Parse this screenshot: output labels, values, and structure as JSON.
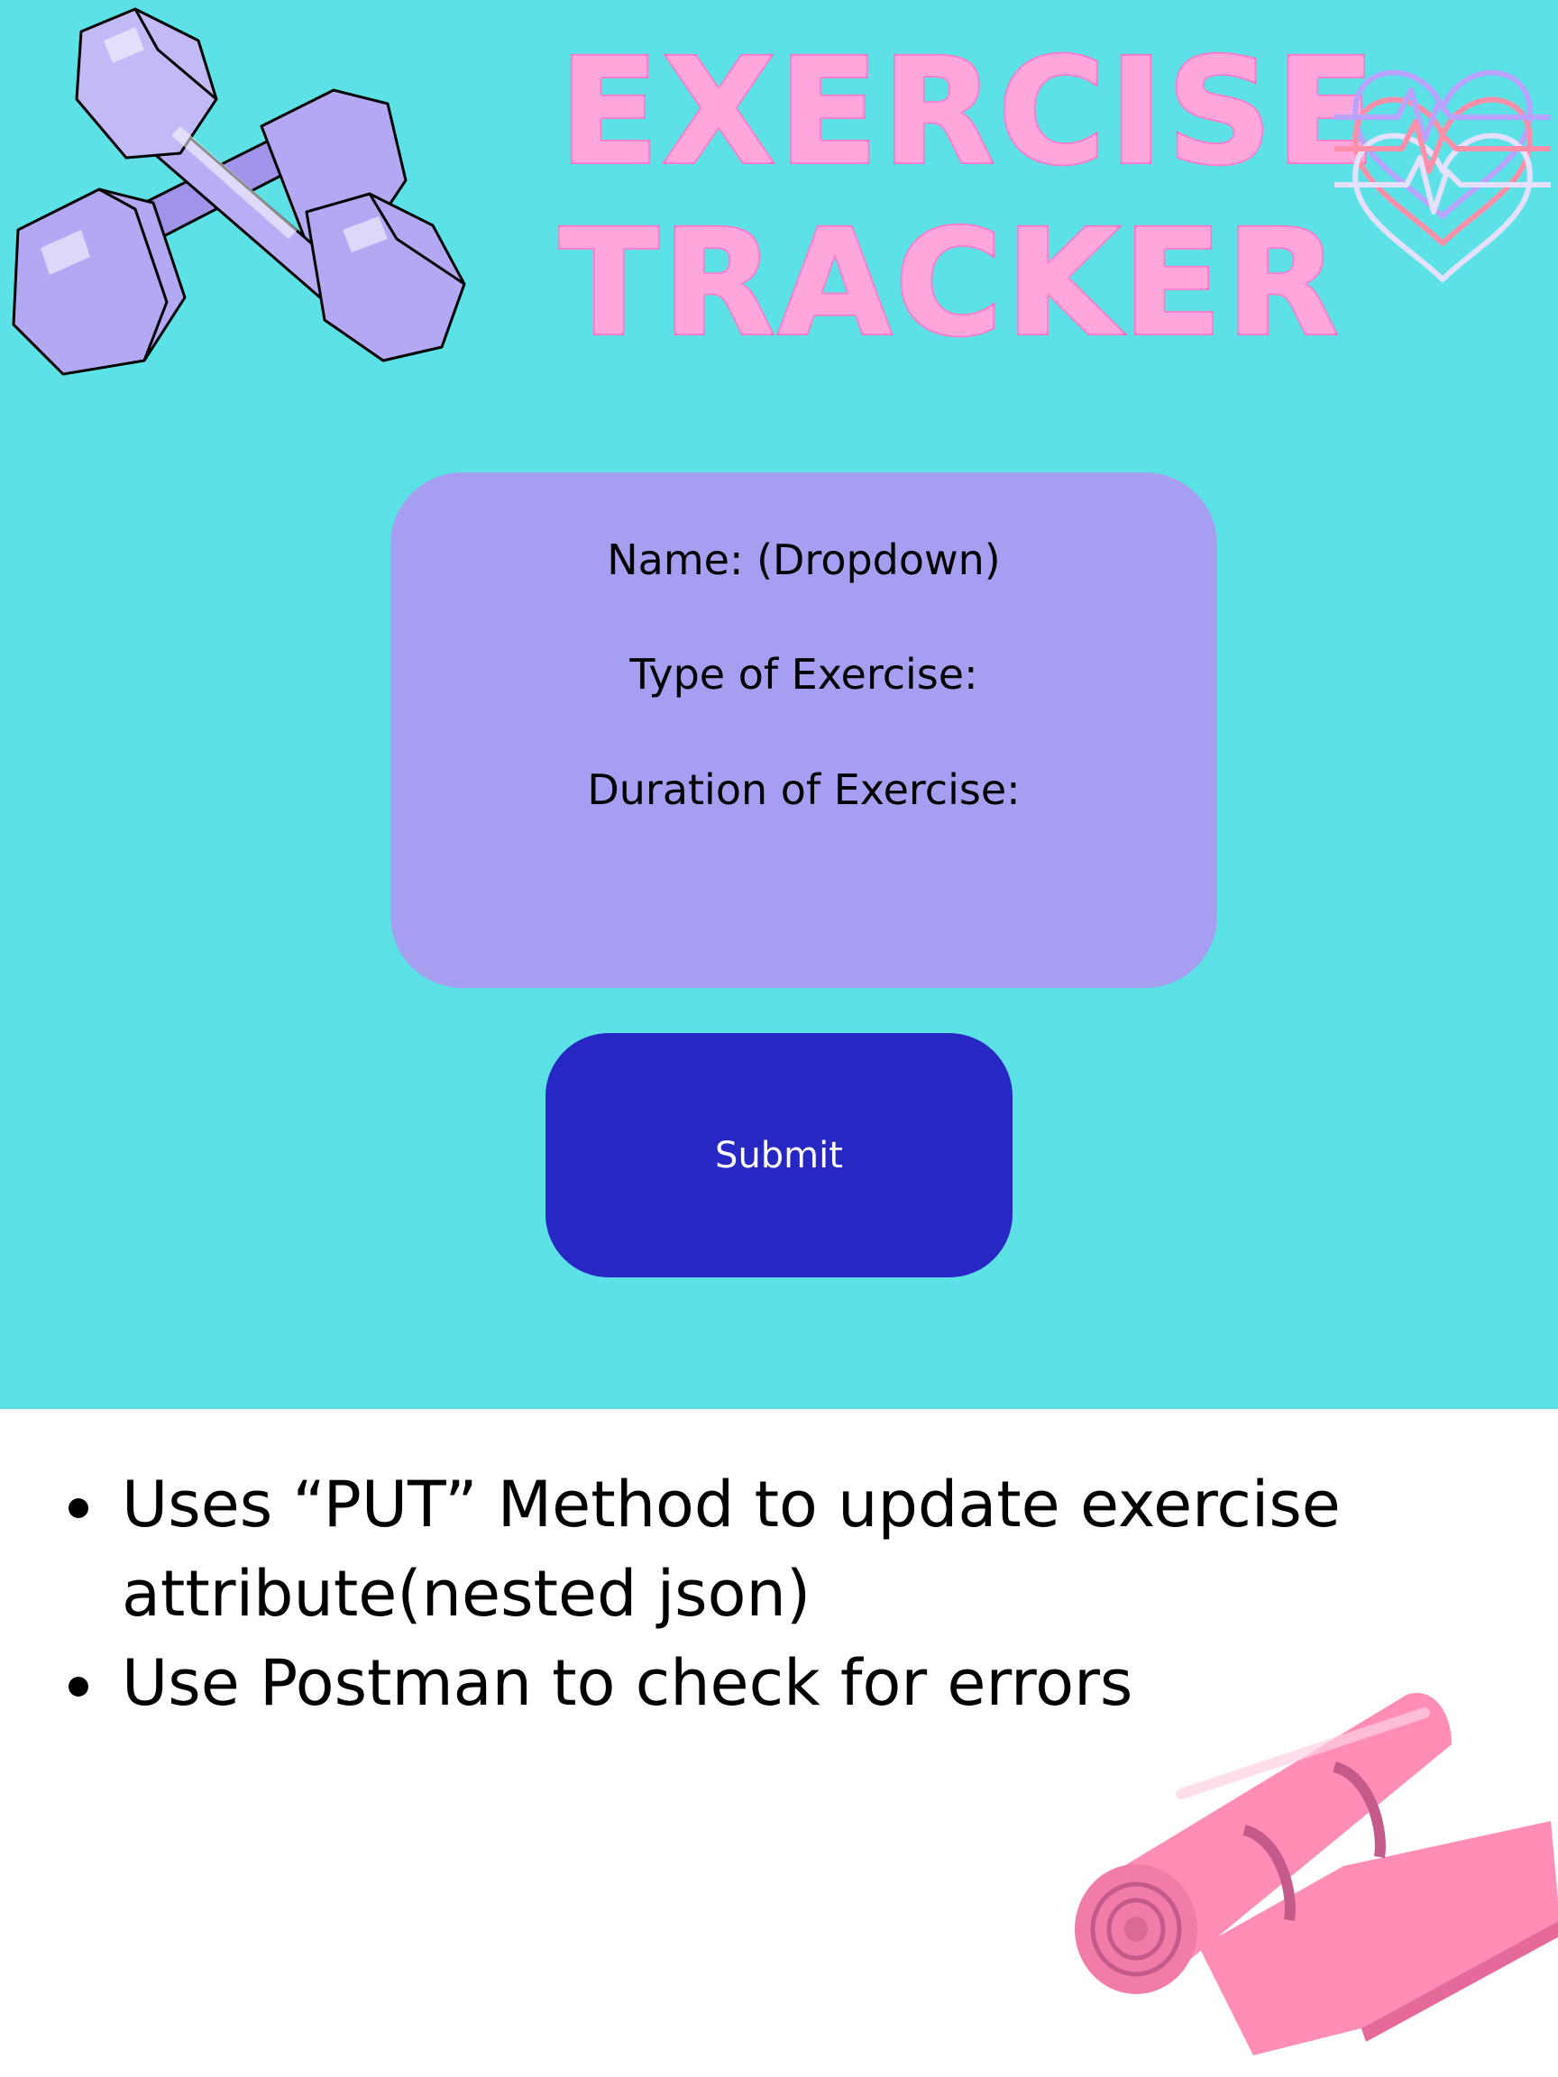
{
  "header": {
    "title_line1": "EXERCISE",
    "title_line2": "TRACKER"
  },
  "form": {
    "name_label": "Name: (Dropdown)",
    "type_label": "Type of Exercise:",
    "duration_label": "Duration of Exercise:"
  },
  "submit": {
    "label": "Submit"
  },
  "notes": {
    "items": [
      "Uses “PUT” Method to update exercise attribute(nested json)",
      "Use Postman to check for errors"
    ]
  },
  "colors": {
    "background": "#5ce1e6",
    "card": "#a69ef0",
    "button": "#2727c4",
    "title_fill": "#ffa6dd",
    "title_stroke": "#ff66c4"
  },
  "icons": {
    "decoration_left": "dumbbell-icon",
    "decoration_right": "heartbeat-icon",
    "decoration_bottom": "yoga-mat-icon"
  }
}
